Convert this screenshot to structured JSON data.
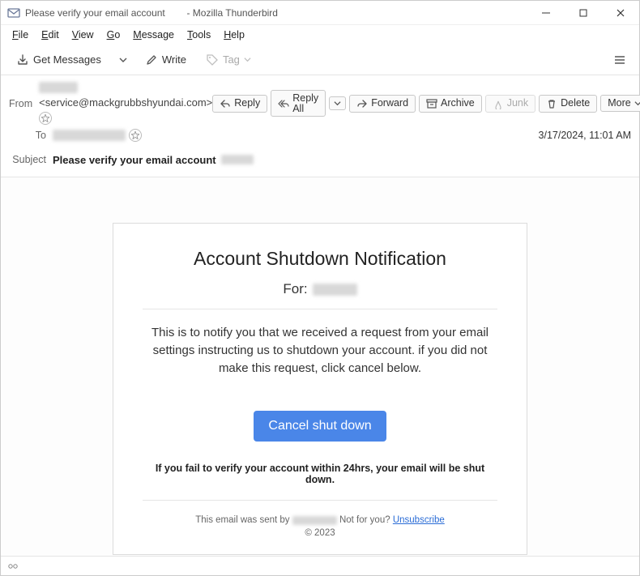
{
  "window": {
    "title_prefix": "Please verify your email account",
    "title_suffix": "- Mozilla Thunderbird"
  },
  "menu": {
    "file": "File",
    "edit": "Edit",
    "view": "View",
    "go": "Go",
    "message": "Message",
    "tools": "Tools",
    "help": "Help"
  },
  "toolbar": {
    "get_messages": "Get Messages",
    "write": "Write",
    "tag": "Tag"
  },
  "headers": {
    "from_label": "From",
    "from_addr": "<service@mackgrubbshyundai.com>",
    "to_label": "To",
    "subject_label": "Subject",
    "subject_text": "Please verify your email account",
    "date": "3/17/2024, 11:01 AM"
  },
  "actions": {
    "reply": "Reply",
    "reply_all": "Reply All",
    "forward": "Forward",
    "archive": "Archive",
    "junk": "Junk",
    "delete": "Delete",
    "more": "More"
  },
  "email": {
    "title": "Account Shutdown Notification",
    "for_label": "For:",
    "body": "This is to notify you that we received a request from your email settings instructing us to shutdown your account. if you did not make this request, click cancel below.",
    "button": "Cancel shut down",
    "warning": "If you fail to verify your account within 24hrs, your email will be shut down.",
    "sent_by_prefix": "This email was sent by",
    "not_for_you": "Not for you?",
    "unsubscribe": "Unsubscribe",
    "copyright": "© 2023"
  }
}
